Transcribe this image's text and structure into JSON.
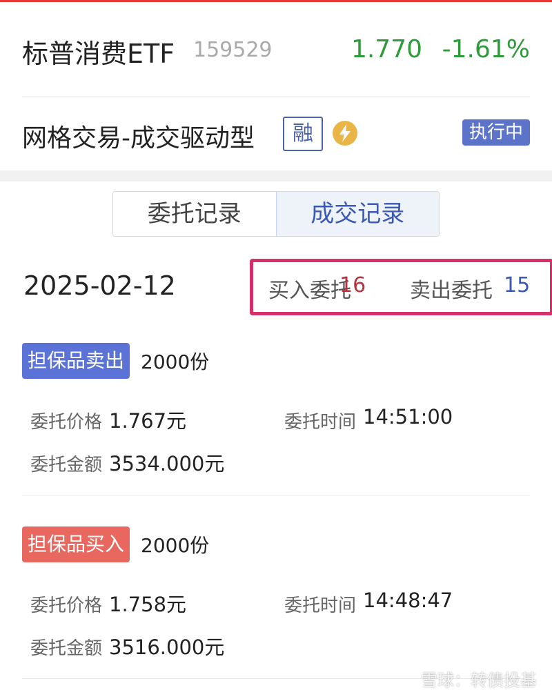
{
  "fund": {
    "name": "标普消费ETF",
    "code": "159529",
    "price": "1.770",
    "change": "-1.61%"
  },
  "strategy": {
    "name": "网格交易-成交驱动型",
    "margin_badge": "融",
    "status": "执行中"
  },
  "tabs": [
    {
      "label": "委托记录",
      "active": false
    },
    {
      "label": "成交记录",
      "active": true
    }
  ],
  "summary": {
    "date": "2025-02-12",
    "buy_label": "买入委托",
    "buy_count": "16",
    "sell_label": "卖出委托",
    "sell_count": "15"
  },
  "records": [
    {
      "type": "担保品卖出",
      "quantity": "2000份",
      "price_label": "委托价格",
      "price": "1.767元",
      "time_label": "委托时间",
      "time": "14:51:00",
      "amount_label": "委托金额",
      "amount": "3534.000元"
    },
    {
      "type": "担保品买入",
      "quantity": "2000份",
      "price_label": "委托价格",
      "price": "1.758元",
      "time_label": "委托时间",
      "time": "14:48:47",
      "amount_label": "委托金额",
      "amount": "3516.000元"
    }
  ],
  "watermark": "雪球：转债投基",
  "colors": {
    "up_down_green": "#2e9b3a",
    "accent_blue": "#3a58b5",
    "sell_badge": "#5b73d6",
    "buy_badge": "#e8675f",
    "highlight_box": "#d4306a"
  }
}
